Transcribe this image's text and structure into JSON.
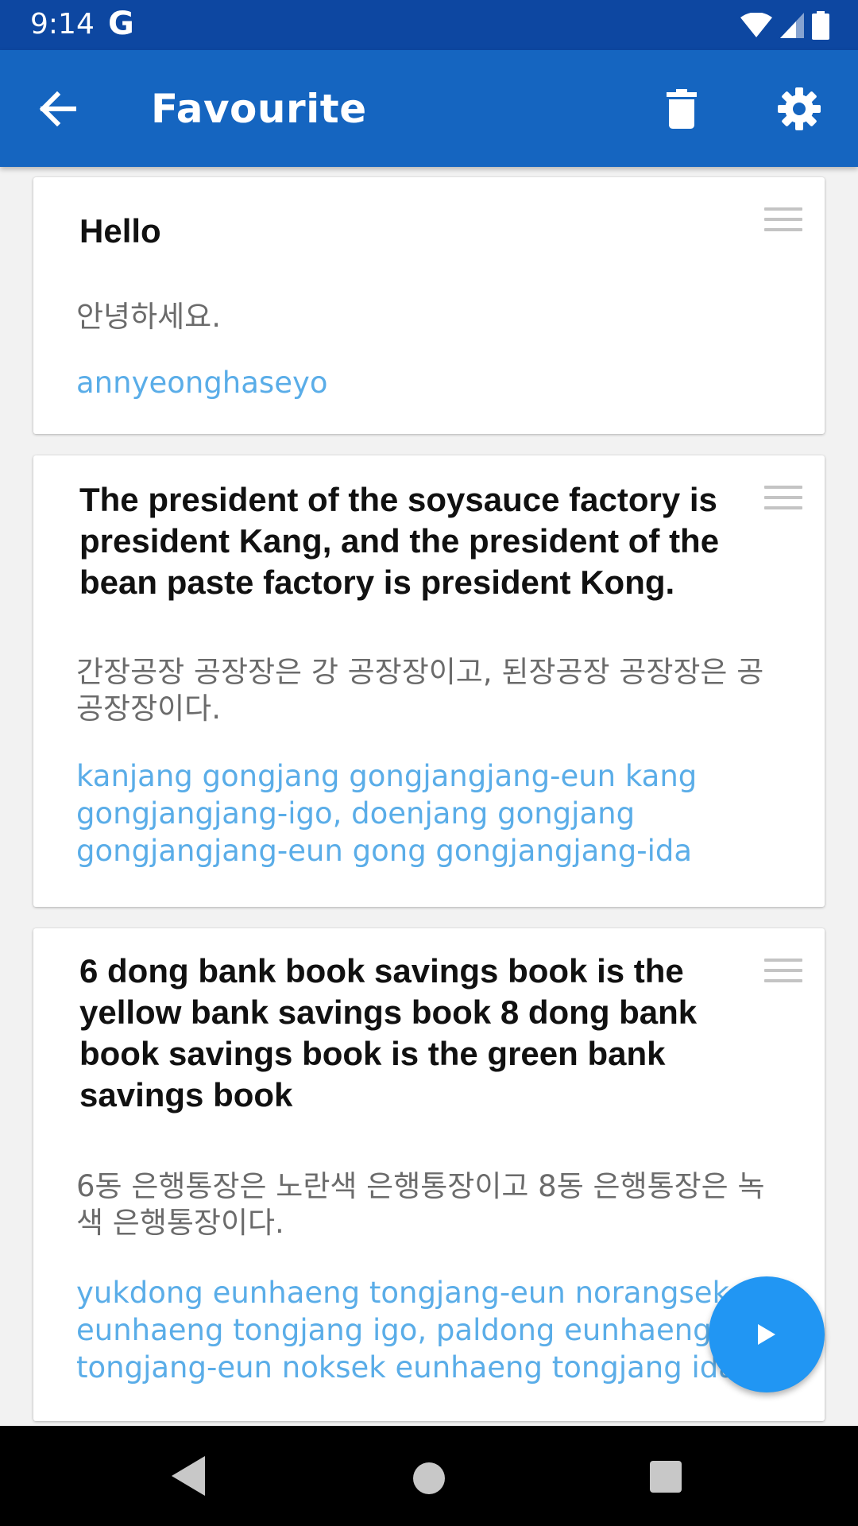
{
  "status_bar": {
    "time": "9:14",
    "google_letter": "G",
    "icons": [
      "wifi-icon",
      "cell-signal-icon",
      "battery-icon"
    ]
  },
  "app_bar": {
    "title": "Favourite",
    "back_icon": "arrow-back-icon",
    "delete_icon": "trash-icon",
    "settings_icon": "gear-icon",
    "background_color": "#1565c0",
    "status_color": "#0d47a1"
  },
  "cards": [
    {
      "english": "Hello",
      "korean": "안녕하세요.",
      "romanized": "annyeonghaseyo"
    },
    {
      "english": "The president of the soysauce factory is president Kang, and the president of the bean paste factory is president Kong.",
      "korean": "간장공장 공장장은 강 공장장이고, 된장공장 공장장은 공 공장장이다.",
      "romanized": "kanjang gongjang gongjangjang-eun kang gongjangjang-igo, doenjang gongjang gongjangjang-eun gong gongjangjang-ida"
    },
    {
      "english": "6 dong bank book savings book is the yellow bank savings book 8 dong bank book savings book is the green bank savings book",
      "korean": "6동 은행통장은 노란색 은행통장이고 8동 은행통장은 녹색 은행통장이다.",
      "romanized": "yukdong eunhaeng tongjang-eun norangsek eunhaeng tongjang igo, paldong eunhaeng tongjang-eun noksek eunhaeng tongjang ida"
    }
  ],
  "fab": {
    "icon": "play-icon",
    "color": "#2196f3"
  },
  "colors": {
    "korean_text": "#6b6b6b",
    "romanized_text": "#5aade8"
  },
  "nav_bar": {
    "icons": [
      "nav-back-icon",
      "nav-home-icon",
      "nav-recents-icon"
    ]
  }
}
